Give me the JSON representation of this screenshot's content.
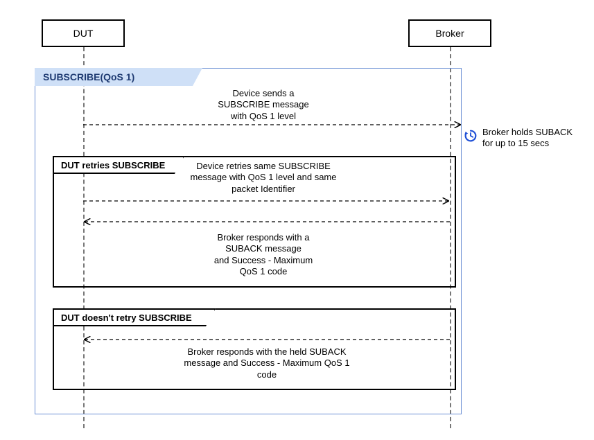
{
  "actors": {
    "dut": "DUT",
    "broker": "Broker"
  },
  "outerFrameTitle": "SUBSCRIBE(QoS 1)",
  "altFrame1Title": "DUT retries SUBSCRIBE",
  "altFrame2Title": "DUT doesn't retry SUBSCRIBE",
  "messages": {
    "initialSubscribe": "Device sends a\nSUBSCRIBE message\nwith QoS 1 level",
    "retrySubscribe": "Device retries same SUBSCRIBE\nmessage with QoS 1 level and same\npacket Identifier",
    "subackAfterRetry": "Broker responds with a\nSUBACK message\nand Success - Maximum\nQoS 1  code",
    "heldSuback": "Broker responds with the held SUBACK\nmessage and Success - Maximum QoS 1\ncode"
  },
  "note": {
    "holdSuback": "Broker holds SUBACK\nfor up to 15 secs",
    "iconName": "clock-icon"
  },
  "chart_data": {
    "type": "sequence-diagram",
    "lifelines": [
      "DUT",
      "Broker"
    ],
    "frame": {
      "label": "SUBSCRIBE(QoS 1)",
      "events": [
        {
          "type": "message",
          "from": "DUT",
          "to": "Broker",
          "style": "dashed",
          "text": "Device sends a SUBSCRIBE message with QoS 1 level"
        },
        {
          "type": "note",
          "at": "Broker",
          "side": "right",
          "icon": "clock",
          "text": "Broker holds SUBACK for up to 15 secs"
        },
        {
          "type": "alt",
          "options": [
            {
              "label": "DUT retries SUBSCRIBE",
              "events": [
                {
                  "type": "message",
                  "from": "DUT",
                  "to": "Broker",
                  "style": "dashed",
                  "text": "Device retries same SUBSCRIBE message with QoS 1 level and same packet Identifier"
                },
                {
                  "type": "message",
                  "from": "Broker",
                  "to": "DUT",
                  "style": "dashed",
                  "text": "Broker responds with a SUBACK message and Success - Maximum QoS 1 code"
                }
              ]
            },
            {
              "label": "DUT doesn't retry SUBSCRIBE",
              "events": [
                {
                  "type": "message",
                  "from": "Broker",
                  "to": "DUT",
                  "style": "dashed",
                  "text": "Broker responds with the held SUBACK message and Success - Maximum QoS 1 code"
                }
              ]
            }
          ]
        }
      ]
    }
  }
}
